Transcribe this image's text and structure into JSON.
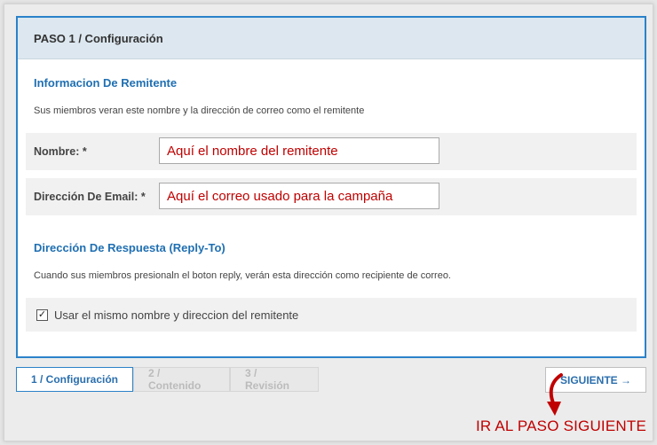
{
  "header": {
    "title": "PASO 1 / Configuración"
  },
  "sender": {
    "title": "Informacion De Remitente",
    "description": "Sus miembros veran este nombre y la dirección de correo como el remitente",
    "name_label": "Nombre: *",
    "name_value": "Aquí el nombre del remitente",
    "email_label": "Dirección De Email: *",
    "email_value": "Aquí el correo usado para la campaña"
  },
  "reply": {
    "title": "Dirección De Respuesta (Reply-To)",
    "description": "Cuando sus miembros presionaln el boton reply, verán esta dirección como recipiente de correo.",
    "checkbox_label": "Usar el mismo nombre y direccion del remitente",
    "checkbox_checked": true,
    "check_mark": "✓"
  },
  "steps": [
    {
      "label": "1 / Configuración",
      "active": true
    },
    {
      "label": "2 / Contenido",
      "active": false
    },
    {
      "label": "3 / Revisión",
      "active": false
    }
  ],
  "next_button": {
    "label": "SIGUIENTE →"
  },
  "annotation": {
    "text": "IR AL PASO SIGUIENTE",
    "color": "#c00000"
  },
  "colors": {
    "accent": "#2b82c9",
    "header_bg": "#dce7ef",
    "title_blue": "#1f6fb2",
    "annotation_red": "#c00000"
  }
}
